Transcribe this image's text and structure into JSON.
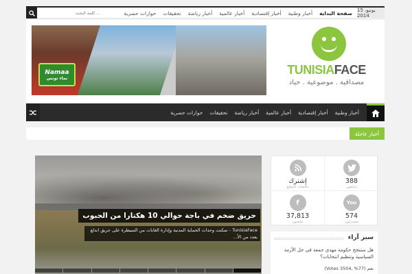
{
  "topbar": {
    "date": "15 يونيو، 2014",
    "search_placeholder": "كلمة البحث ...",
    "nav": [
      "صفحة البداية",
      "أخبار وطنية",
      "أخبار إقتصادية",
      "أخبار عالمية",
      "أخبار رياضة",
      "تحقيقات",
      "حوارات حصرية"
    ]
  },
  "header": {
    "banner_badge": "Namaa",
    "banner_badge_sub": "نماء تونس",
    "logo_part1": "TUNISIA",
    "logo_part2": "FACE",
    "slogan": "مصداقية . موضوعية . حياد"
  },
  "mainnav": {
    "items": [
      "أخبار وطنية",
      "أخبار إقتصادية",
      "أخبار عالمية",
      "أخبار رياضة",
      "تحقيقات",
      "حوارات حصرية"
    ]
  },
  "breaking": {
    "label": "أخبار عاجلة"
  },
  "slider": {
    "title": "حريق ضخم في باجة حوالي 10 هكتارا من الحبوب",
    "excerpt": "TunisiaFace - تمكنت وحدات الحماية المدنية وإدارة الغابات من السيطرة على حريق اندلع بعدد من الأ...",
    "slides": 8,
    "active": 8
  },
  "social": {
    "twitter": {
      "icon": "twitter-icon",
      "count": "388",
      "label": "متابعون"
    },
    "rss": {
      "icon": "rss-icon",
      "count": "إشترك",
      "label": "خلاصات الموقع"
    },
    "youtube": {
      "icon": "youtube-icon",
      "count": "574",
      "label": "مشتركون",
      "glyph": "You"
    },
    "facebook": {
      "icon": "facebook-icon",
      "count": "37,813",
      "label": "معجبون",
      "glyph": "f"
    }
  },
  "poll": {
    "title": "سبر آراء",
    "question": "هل ستنجح حكومة مهدي جمعة في حل الأزمة السياسية وتنظيم انتخابات؟",
    "option": "نعم (77% ,3504 Votes)"
  },
  "colors": {
    "accent": "#8cc63f",
    "dark": "#2b2b2b"
  }
}
